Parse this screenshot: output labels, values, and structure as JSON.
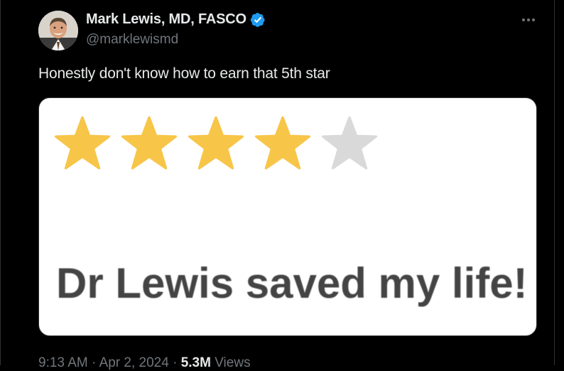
{
  "author": {
    "display_name": "Mark Lewis, MD, FASCO",
    "handle": "@marklewismd",
    "verified": true,
    "verified_color": "#1d9bf0"
  },
  "tweet": {
    "text": "Honestly don't know how to earn that 5th star"
  },
  "media": {
    "rating": {
      "filled": 4,
      "total": 5,
      "filled_color": "#f7c548",
      "empty_color": "#d9d9d9"
    },
    "review_text": "Dr Lewis saved my life!"
  },
  "meta": {
    "time": "9:13 AM",
    "sep1": " · ",
    "date": "Apr 2, 2024",
    "sep2": " · ",
    "views_count": "5.3M",
    "views_label": " Views"
  },
  "icons": {
    "more": "more-horizontal-icon",
    "verified": "verified-badge-icon"
  }
}
